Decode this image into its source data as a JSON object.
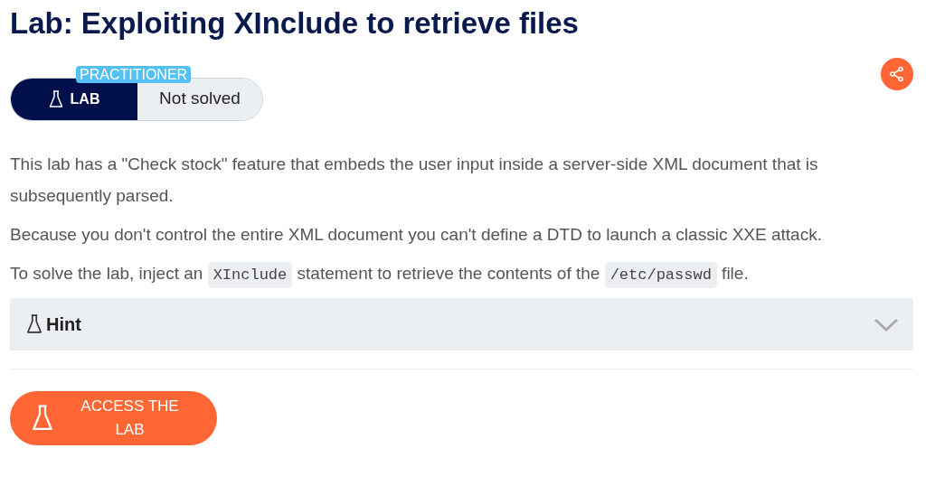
{
  "title": "Lab: Exploiting XInclude to retrieve files",
  "lab_badge": {
    "level": "PRACTITIONER",
    "label": "LAB",
    "status": "Not solved",
    "solved": false
  },
  "paragraphs": [
    [
      {
        "kind": "text",
        "text": "This lab has a \"Check stock\" feature that embeds the user input inside a server-side XML document that is subsequently parsed."
      }
    ],
    [
      {
        "kind": "text",
        "text": "Because you don't control the entire XML document you can't define a DTD to launch a classic XXE attack."
      }
    ],
    [
      {
        "kind": "text",
        "text": "To solve the lab, inject an "
      },
      {
        "kind": "code",
        "text": "XInclude"
      },
      {
        "kind": "text",
        "text": " statement to retrieve the contents of the "
      },
      {
        "kind": "code",
        "text": "/etc/passwd"
      },
      {
        "kind": "text",
        "text": " file."
      }
    ]
  ],
  "hint": {
    "label": "Hint",
    "expanded": false
  },
  "access_button": {
    "label": "ACCESS THE LAB"
  }
}
